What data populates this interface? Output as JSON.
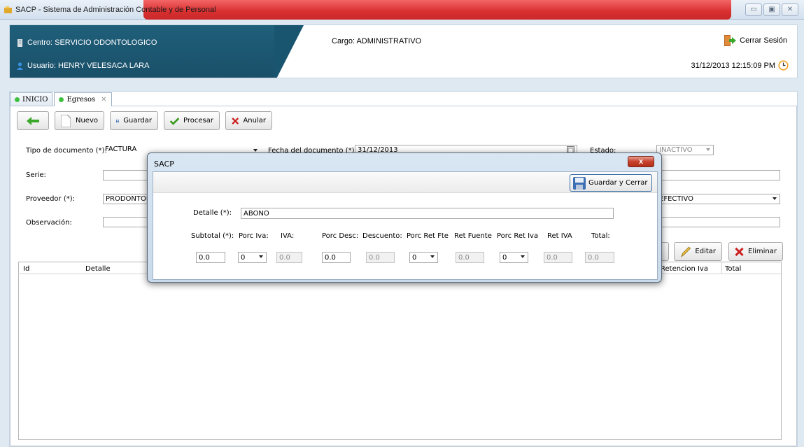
{
  "window": {
    "title": "SACP - Sistema de Administración Contable y de Personal",
    "controls": [
      "minimize",
      "maximize",
      "close"
    ]
  },
  "header": {
    "centro": "Centro: SERVICIO ODONTOLOGICO",
    "usuario": "Usuario: HENRY VELESACA LARA",
    "cargo": "Cargo:  ADMINISTRATIVO",
    "logout": "Cerrar Sesión",
    "datetime": "31/12/2013 12:15:09 PM"
  },
  "tabs": [
    {
      "label": "INICIO"
    },
    {
      "label": "Egresos"
    }
  ],
  "toolbar": {
    "back_icon": "back-arrow-icon",
    "nuevo": "Nuevo",
    "guardar": "Guardar",
    "procesar": "Procesar",
    "anular": "Anular"
  },
  "form": {
    "tipo_label": "Tipo de documento (*):",
    "tipo_value": "FACTURA",
    "fecha_label": "Fecha del documento (*):",
    "fecha_value": "31/12/2013",
    "estado_label": "Estado:",
    "estado_value": "INACTIVO",
    "serie_label": "Serie:",
    "serie_value": "",
    "proveedor_label": "Proveedor (*):",
    "proveedor_value": "PRODONTOMED",
    "pago_value": "EFECTIVO",
    "observacion_label": "Observación:",
    "observacion_value": ""
  },
  "actions": {
    "editar": "Editar",
    "eliminar": "Eliminar"
  },
  "grid": {
    "columns": [
      "Id",
      "Detalle",
      "Retencion Iva",
      "Total"
    ]
  },
  "modal": {
    "title": "SACP",
    "close": "x",
    "save_close": "Guardar y Cerrar",
    "detalle_label": "Detalle (*):",
    "detalle_value": "ABONO",
    "headers": [
      "Subtotal (*):",
      "Porc Iva:",
      "IVA:",
      "Porc Desc:",
      "Descuento:",
      "Porc Ret Fte",
      "Ret Fuente",
      "Porc Ret Iva",
      "Ret IVA",
      "Total:"
    ],
    "values": {
      "subtotal": "0.0",
      "porc_iva": "0",
      "iva": "0.0",
      "porc_desc": "0.0",
      "descuento": "0.0",
      "porc_ret_fte": "0",
      "ret_fuente": "0.0",
      "porc_ret_iva": "0",
      "ret_iva": "0.0",
      "total": "0.0"
    }
  },
  "colors": {
    "header_dark": "#1a4f68",
    "titlebar_red": "#d81e1e",
    "tab_dot": "#3fbf3f",
    "eliminar_red": "#cc1f1f",
    "procesar_green": "#3a9a1e"
  }
}
